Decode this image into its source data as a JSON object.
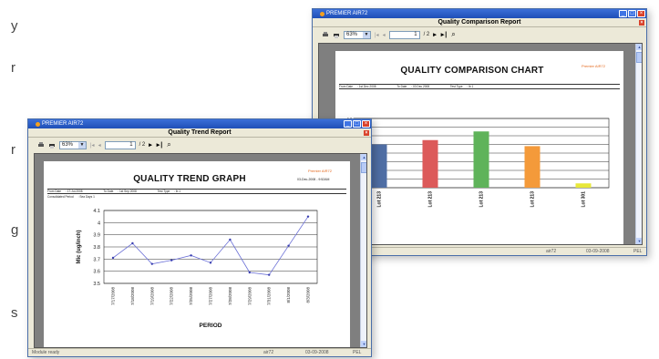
{
  "background_letters": [
    "y",
    "r",
    "r",
    "g",
    "s"
  ],
  "back_window": {
    "app_title": "PREMIER AIR72",
    "report_title": "Quality Comparison Report",
    "zoom": "63%",
    "page_current": "1",
    "page_total": "/ 2",
    "chart_title": "QUALITY COMPARISON CHART",
    "brand": "Premier AIR72",
    "meta": [
      "From Date",
      ": 1st Dec 2008",
      "To Date",
      ": 03 Dec 2008",
      "Test Type",
      ": lb 1"
    ],
    "status": {
      "user": "air72",
      "date": "03-09-2008",
      "company": "PEL"
    }
  },
  "front_window": {
    "app_title": "PREMIER AIR72",
    "report_title": "Quality Trend Report",
    "zoom": "63%",
    "page_current": "1",
    "page_total": "/ 2",
    "chart_title": "QUALITY TREND GRAPH",
    "brand": "Premier AIR72",
    "printed": "03-Dec-2008 - 9:52AM",
    "meta": [
      "From Date",
      ": 17-Jul-2008",
      "To Date",
      ": 1st Sep 2008",
      "Test Type",
      ": lb 1"
    ],
    "meta2": [
      "Consolidated Period",
      ": Sea Days 1"
    ],
    "status": {
      "left": "Module ready",
      "user": "air72",
      "date": "03-09-2008",
      "company": "PEL"
    }
  },
  "chart_data": [
    {
      "type": "line",
      "title": "QUALITY TREND GRAPH",
      "xlabel": "PERIOD",
      "ylabel": "Mic (ug/inch)",
      "ylim": [
        3.5,
        4.1
      ],
      "yticks": [
        "4.1",
        "4",
        "3.9",
        "3.8",
        "3.7",
        "3.6",
        "3.5"
      ],
      "grid": true,
      "categories": [
        "7/17/2008",
        "7/18/2008",
        "7/19/2008",
        "7/22/2008",
        "7/25/2008",
        "7/27/2008",
        "7/28/2008",
        "7/29/2008",
        "7/31/2008",
        "8/1/2008",
        "8/3/2008"
      ],
      "values": [
        3.71,
        3.83,
        3.66,
        3.69,
        3.73,
        3.67,
        3.86,
        3.59,
        3.57,
        3.81,
        4.05
      ],
      "color": "#6a6fd6"
    },
    {
      "type": "bar",
      "title": "QUALITY COMPARISON CHART",
      "ylim": [
        3.5,
        4.3
      ],
      "yticks": [
        "4.3",
        "4.2",
        "4.1",
        "4",
        "3.9",
        "3.8",
        "3.7",
        "3.6",
        "3.5"
      ],
      "grid": true,
      "categories": [
        "Lot 213",
        "Lot 213",
        "Lot 213",
        "Lot 213",
        "Lot 301"
      ],
      "values": [
        4.0,
        4.05,
        4.15,
        3.98,
        3.55
      ],
      "colors": [
        "#4f6ea4",
        "#dc5a5a",
        "#5fb35a",
        "#f49a3a",
        "#e8e83a"
      ]
    }
  ]
}
